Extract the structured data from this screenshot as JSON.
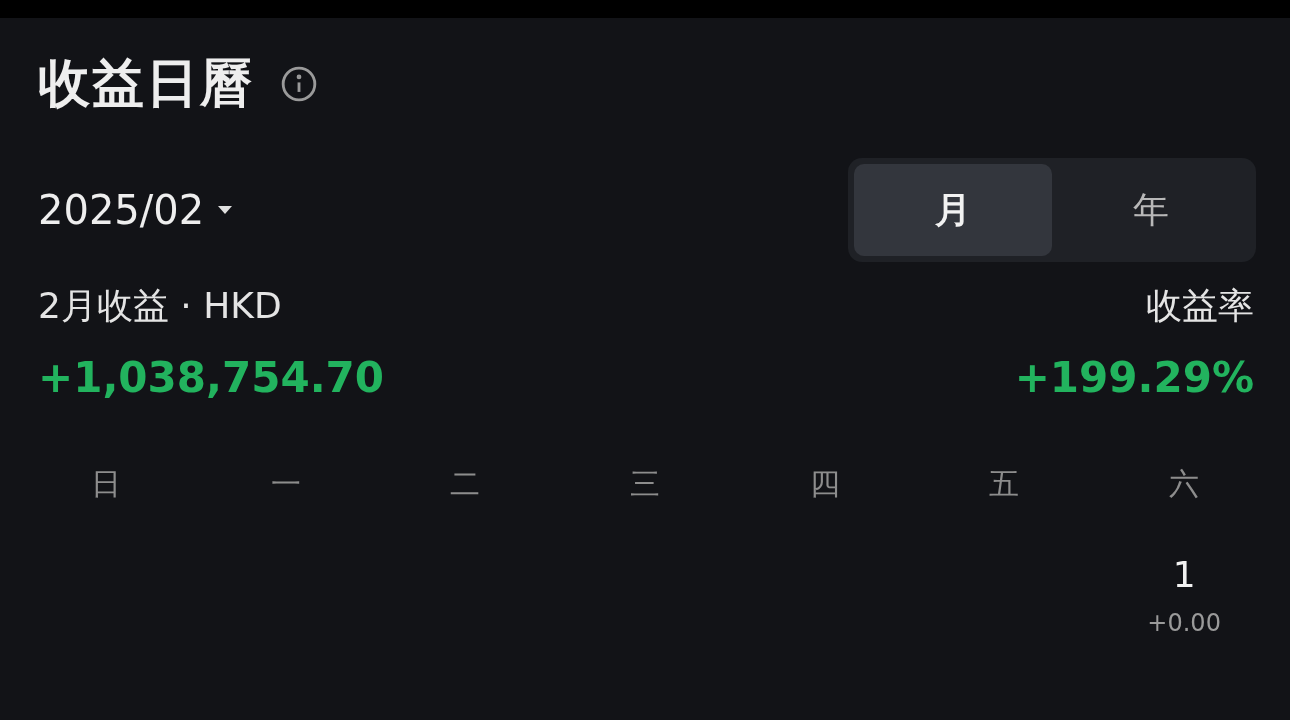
{
  "title": "收益日曆",
  "period": {
    "value": "2025/02"
  },
  "view_toggle": [
    {
      "label": "月",
      "selected": true
    },
    {
      "label": "年",
      "selected": false
    }
  ],
  "summary": {
    "profit_label": "2月收益 · HKD",
    "profit_value": "+1,038,754.70",
    "rate_label": "收益率",
    "rate_value": "+199.29%"
  },
  "weekdays": [
    "日",
    "一",
    "二",
    "三",
    "四",
    "五",
    "六"
  ],
  "week": [
    {
      "kind": "empty"
    },
    {
      "kind": "empty"
    },
    {
      "kind": "empty"
    },
    {
      "kind": "empty"
    },
    {
      "kind": "empty"
    },
    {
      "kind": "empty"
    },
    {
      "kind": "day",
      "day": "1",
      "value": "+0.00"
    }
  ]
}
